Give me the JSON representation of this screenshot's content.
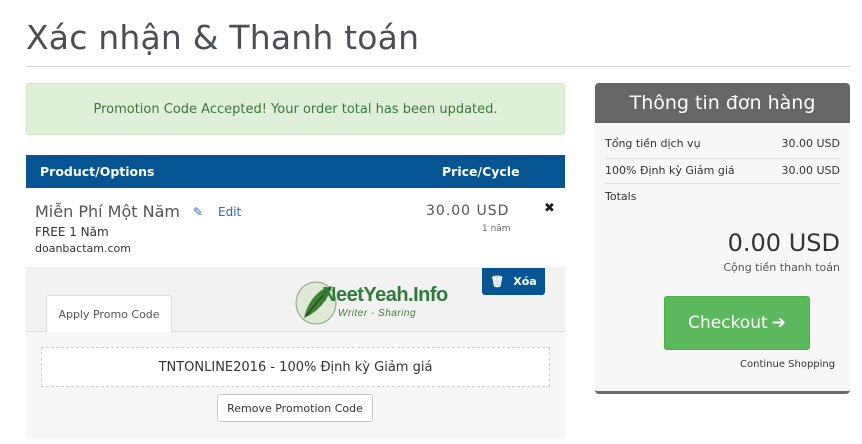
{
  "page": {
    "title": "Xác nhận & Thanh toán"
  },
  "alert": {
    "message": "Promotion Code Accepted! Your order total has been updated."
  },
  "cart": {
    "header": {
      "product": "Product/Options",
      "price": "Price/Cycle"
    },
    "item": {
      "name": "Miễn Phí Một Năm",
      "edit_label": "Edit",
      "plan": "FREE 1 Năm",
      "domain": "doanbactam.com",
      "price": "30.00 USD",
      "cycle": "1 năm",
      "remove_glyph": "✖"
    },
    "delete_label": "Xóa"
  },
  "promo": {
    "tab_label": "Apply Promo Code",
    "applied_code": "TNTONLINE2016 - 100% Định kỳ Giảm giá",
    "remove_label": "Remove Promotion Code"
  },
  "watermark": {
    "brand": "NeetYeah.Info",
    "tagline": "Writer - Sharing"
  },
  "summary": {
    "title": "Thông tin đơn hàng",
    "rows": [
      {
        "label": "Tổng tiền dịch vụ",
        "value": "30.00 USD"
      },
      {
        "label": "100% Định kỳ Giảm giá",
        "value": "30.00 USD"
      }
    ],
    "totals_label": "Totals",
    "total_value": "0.00 USD",
    "total_caption": "Cộng tiền thanh toán",
    "checkout_label": "Checkout",
    "continue_label": "Continue Shopping"
  },
  "colors": {
    "header_blue": "#045591",
    "checkout_green": "#5cb85c",
    "alert_bg": "#dff0d8",
    "summary_header": "#666666"
  },
  "icons": [
    "pencil-icon",
    "times-icon",
    "trash-icon",
    "arrow-right-icon"
  ]
}
